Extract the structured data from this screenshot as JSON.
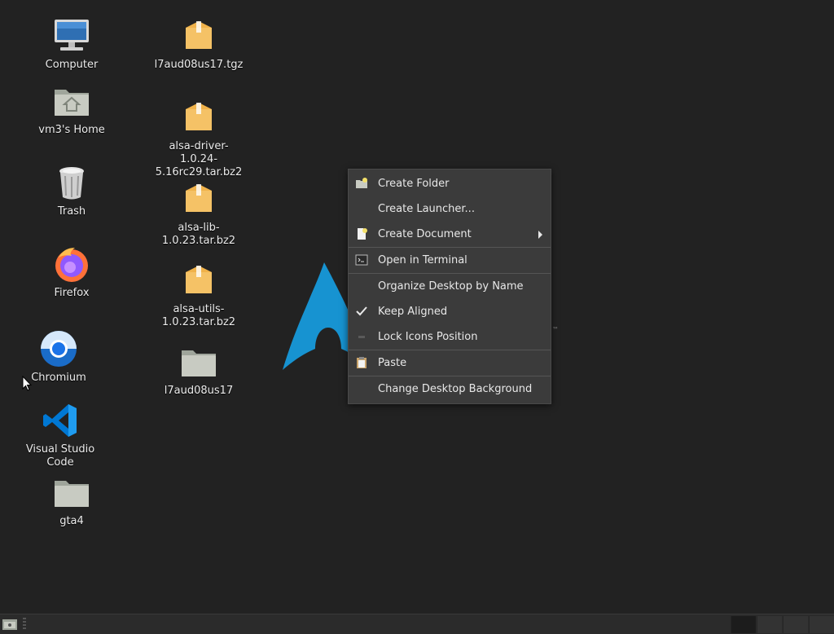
{
  "desktop_icons": {
    "computer": "Computer",
    "home": "vm3's Home",
    "trash": "Trash",
    "firefox": "Firefox",
    "chromium": "Chromium",
    "vscode": "Visual Studio Code",
    "gta4": "gta4",
    "file1": "l7aud08us17.tgz",
    "file2": "alsa-driver-1.0.24-5.16rc29.tar.bz2",
    "file3": "alsa-lib-1.0.23.tar.bz2",
    "file4": "alsa-utils-1.0.23.tar.bz2",
    "folder1": "l7aud08us17"
  },
  "context_menu": {
    "create_folder": "Create Folder",
    "create_launcher": "Create Launcher...",
    "create_document": "Create Document",
    "open_terminal": "Open in Terminal",
    "organize": "Organize Desktop by Name",
    "keep_aligned": "Keep Aligned",
    "lock_icons": "Lock Icons Position",
    "paste": "Paste",
    "change_bg": "Change Desktop Background"
  },
  "colors": {
    "desktop_bg": "#222222",
    "menu_bg": "#3b3b3b",
    "arch_blue": "#1793d1",
    "package_orange": "#f0b24a"
  }
}
